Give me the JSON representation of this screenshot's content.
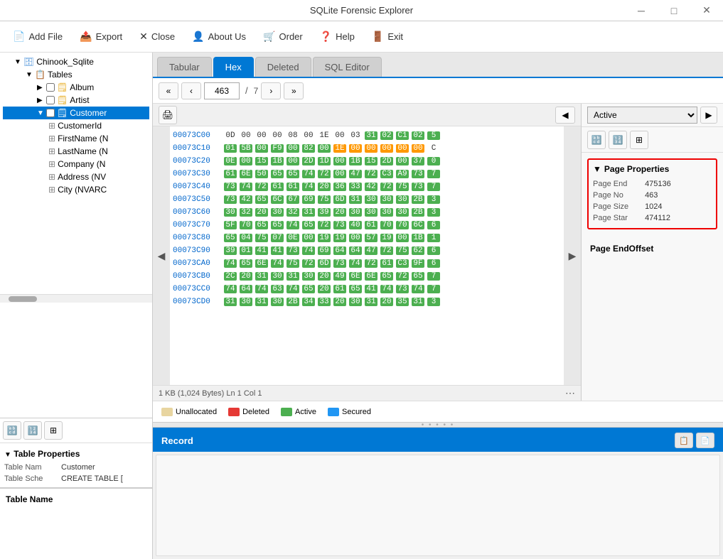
{
  "window": {
    "title": "SQLite Forensic Explorer"
  },
  "menu": {
    "add_file": "Add File",
    "export": "Export",
    "close": "Close",
    "about_us": "About Us",
    "order": "Order",
    "help": "Help",
    "exit": "Exit"
  },
  "tabs": {
    "tabular": "Tabular",
    "hex": "Hex",
    "deleted": "Deleted",
    "sql_editor": "SQL Editor"
  },
  "navigation": {
    "first": "«",
    "prev": "‹",
    "page": "463",
    "separator": "/",
    "total": "7",
    "next": "›",
    "last": "»"
  },
  "hex_view": {
    "status": "1 KB (1,024 Bytes)  Ln 1   Col 1",
    "rows": [
      {
        "offset": "00073C00",
        "bytes": [
          "0D",
          "00",
          "00",
          "00",
          "08",
          "00",
          "1E",
          "00",
          "03",
          "31",
          "02",
          "C1",
          "02",
          "5"
        ]
      },
      {
        "offset": "00073C10",
        "bytes": [
          "01",
          "5B",
          "00",
          "F9",
          "00",
          "82",
          "00",
          "1E",
          "00",
          "00",
          "00",
          "00",
          "00",
          "C"
        ]
      },
      {
        "offset": "00073C20",
        "bytes": [
          "0E",
          "00",
          "15",
          "1B",
          "00",
          "2D",
          "1D",
          "00",
          "1B",
          "15",
          "2D",
          "00",
          "37",
          "0"
        ]
      },
      {
        "offset": "00073C30",
        "bytes": [
          "61",
          "6E",
          "50",
          "65",
          "65",
          "74",
          "72",
          "00",
          "47",
          "72",
          "C3",
          "A9",
          "73",
          "7"
        ]
      },
      {
        "offset": "00073C40",
        "bytes": [
          "73",
          "74",
          "72",
          "61",
          "61",
          "74",
          "20",
          "36",
          "33",
          "42",
          "72",
          "75",
          "73",
          "7"
        ]
      },
      {
        "offset": "00073C50",
        "bytes": [
          "73",
          "42",
          "65",
          "6C",
          "67",
          "69",
          "75",
          "6D",
          "31",
          "30",
          "30",
          "30",
          "2B",
          "3"
        ]
      },
      {
        "offset": "00073C60",
        "bytes": [
          "30",
          "32",
          "20",
          "30",
          "32",
          "31",
          "39",
          "20",
          "30",
          "30",
          "30",
          "30",
          "2B",
          "3"
        ]
      },
      {
        "offset": "00073C70",
        "bytes": [
          "5F",
          "70",
          "65",
          "65",
          "74",
          "65",
          "72",
          "73",
          "40",
          "61",
          "70",
          "70",
          "6C",
          "6"
        ]
      },
      {
        "offset": "00073C80",
        "bytes": [
          "65",
          "04",
          "75",
          "07",
          "0E",
          "00",
          "19",
          "19",
          "00",
          "57",
          "19",
          "00",
          "1B",
          "1"
        ]
      },
      {
        "offset": "00073C90",
        "bytes": [
          "39",
          "01",
          "41",
          "41",
          "73",
          "74",
          "69",
          "64",
          "64",
          "47",
          "72",
          "75",
          "62",
          "6"
        ]
      },
      {
        "offset": "00073CA0",
        "bytes": [
          "74",
          "65",
          "6E",
          "74",
          "75",
          "72",
          "6D",
          "73",
          "74",
          "72",
          "61",
          "C3",
          "9F",
          "6"
        ]
      },
      {
        "offset": "00073CB0",
        "bytes": [
          "2C",
          "20",
          "31",
          "30",
          "31",
          "30",
          "20",
          "49",
          "6E",
          "6E",
          "65",
          "72",
          "65",
          "7"
        ]
      },
      {
        "offset": "00073CC0",
        "bytes": [
          "74",
          "64",
          "74",
          "63",
          "74",
          "65",
          "20",
          "61",
          "65",
          "41",
          "74",
          "73",
          "74",
          "7"
        ]
      },
      {
        "offset": "00073CD0",
        "bytes": [
          "31",
          "30",
          "31",
          "30",
          "2B",
          "34",
          "33",
          "20",
          "30",
          "31",
          "20",
          "35",
          "31",
          "3"
        ]
      }
    ]
  },
  "page_properties": {
    "title": "Page Properties",
    "end_label": "Page End",
    "end_value": "475136",
    "no_label": "Page No",
    "no_value": "463",
    "size_label": "Page Size",
    "size_value": "1024",
    "star_label": "Page Star",
    "star_value": "474112"
  },
  "page_end_offset": {
    "title": "Page EndOffset"
  },
  "active_status": "Active",
  "legend": {
    "unallocated_label": "Unallocated",
    "deleted_label": "Deleted",
    "active_label": "Active",
    "secured_label": "Secured"
  },
  "record": {
    "title": "Record"
  },
  "tree": {
    "database": "Chinook_Sqlite",
    "tables_label": "Tables",
    "items": [
      {
        "label": "Album",
        "indent": 3
      },
      {
        "label": "Artist",
        "indent": 3
      },
      {
        "label": "Customer",
        "indent": 3,
        "selected": true
      },
      {
        "label": "CustomerId",
        "indent": 4
      },
      {
        "label": "FirstName (N",
        "indent": 4
      },
      {
        "label": "LastName (N",
        "indent": 4
      },
      {
        "label": "Company (N",
        "indent": 4
      },
      {
        "label": "Address (NV",
        "indent": 4
      },
      {
        "label": "City (NVARC",
        "indent": 4
      }
    ]
  },
  "table_properties": {
    "title": "Table Properties",
    "name_key": "Table Nam",
    "name_value": "Customer",
    "schema_key": "Table Sche",
    "schema_value": "CREATE TABLE ["
  },
  "table_name_label": "Table Name"
}
